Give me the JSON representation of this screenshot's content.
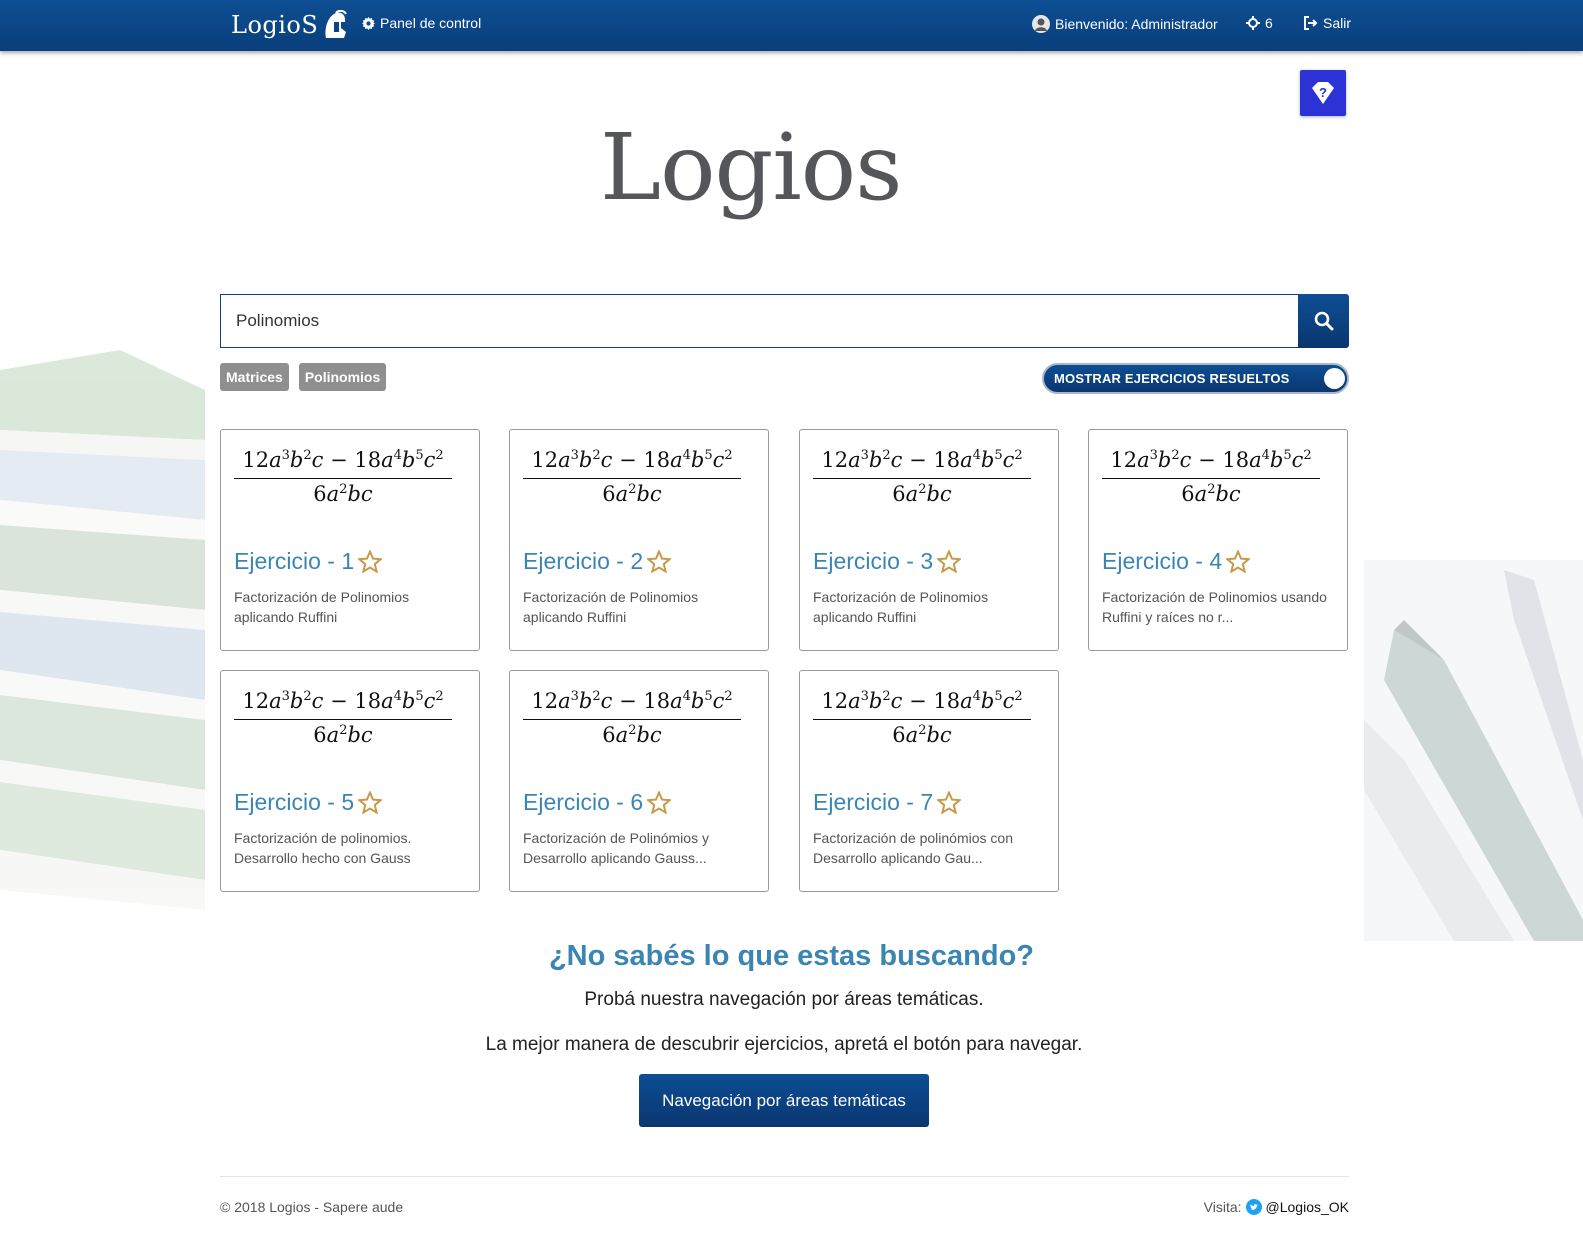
{
  "navbar": {
    "brand": "LogioS",
    "panel_label": "Panel de control",
    "welcome_label": "Bienvenido: Administrador",
    "points": "6",
    "exit_label": "Salir"
  },
  "logo_text": "Logios",
  "search": {
    "value": "Polinomios"
  },
  "tags": [
    "Matrices",
    "Polinomios"
  ],
  "toggle_label": "MOSTRAR EJERCICIOS RESUELTOS",
  "cards": [
    {
      "title": "Ejercicio - 1",
      "desc": "Factorización de Polinomios aplicando Ruffini"
    },
    {
      "title": "Ejercicio - 2",
      "desc": "Factorización de Polinomios aplicando Ruffini"
    },
    {
      "title": "Ejercicio - 3",
      "desc": "Factorización de Polinomios aplicando Ruffini"
    },
    {
      "title": "Ejercicio - 4",
      "desc": "Factorización de Polinomios usando Ruffini y raíces no r..."
    },
    {
      "title": "Ejercicio - 5",
      "desc": "Factorización de polinomios. Desarrollo hecho con Gauss"
    },
    {
      "title": "Ejercicio - 6",
      "desc": "Factorización de Polinómios y Desarrollo aplicando Gauss..."
    },
    {
      "title": "Ejercicio - 7",
      "desc": "Factorización de polinómios con Desarrollo aplicando Gau..."
    }
  ],
  "formula": {
    "num": "12a³b²c − 18a⁴b⁵c²",
    "den": "6a²bc"
  },
  "bottom": {
    "title": "¿No sabés lo que estas buscando?",
    "line1": "Probá nuestra navegación por áreas temáticas.",
    "line2": "La mejor manera de descubrir ejercicios, apretá el botón para navegar.",
    "button": "Navegación por áreas temáticas"
  },
  "footer": {
    "copyright": "© 2018 Logios - Sapere aude",
    "visit_label": "Visita:",
    "twitter": "@Logios_OK"
  },
  "colors": {
    "navbar": "#0d4e93",
    "accent_title": "#3b85b5",
    "star": "#c79a4a",
    "help_button": "#2b32d6",
    "tag": "#8f8f8f"
  },
  "icons": {
    "panel": "gear-icon",
    "user": "user-avatar-icon",
    "points": "points-icon",
    "exit": "exit-icon",
    "help": "shield-question-icon",
    "search": "search-icon",
    "star": "star-outline-icon",
    "twitter": "twitter-icon"
  }
}
